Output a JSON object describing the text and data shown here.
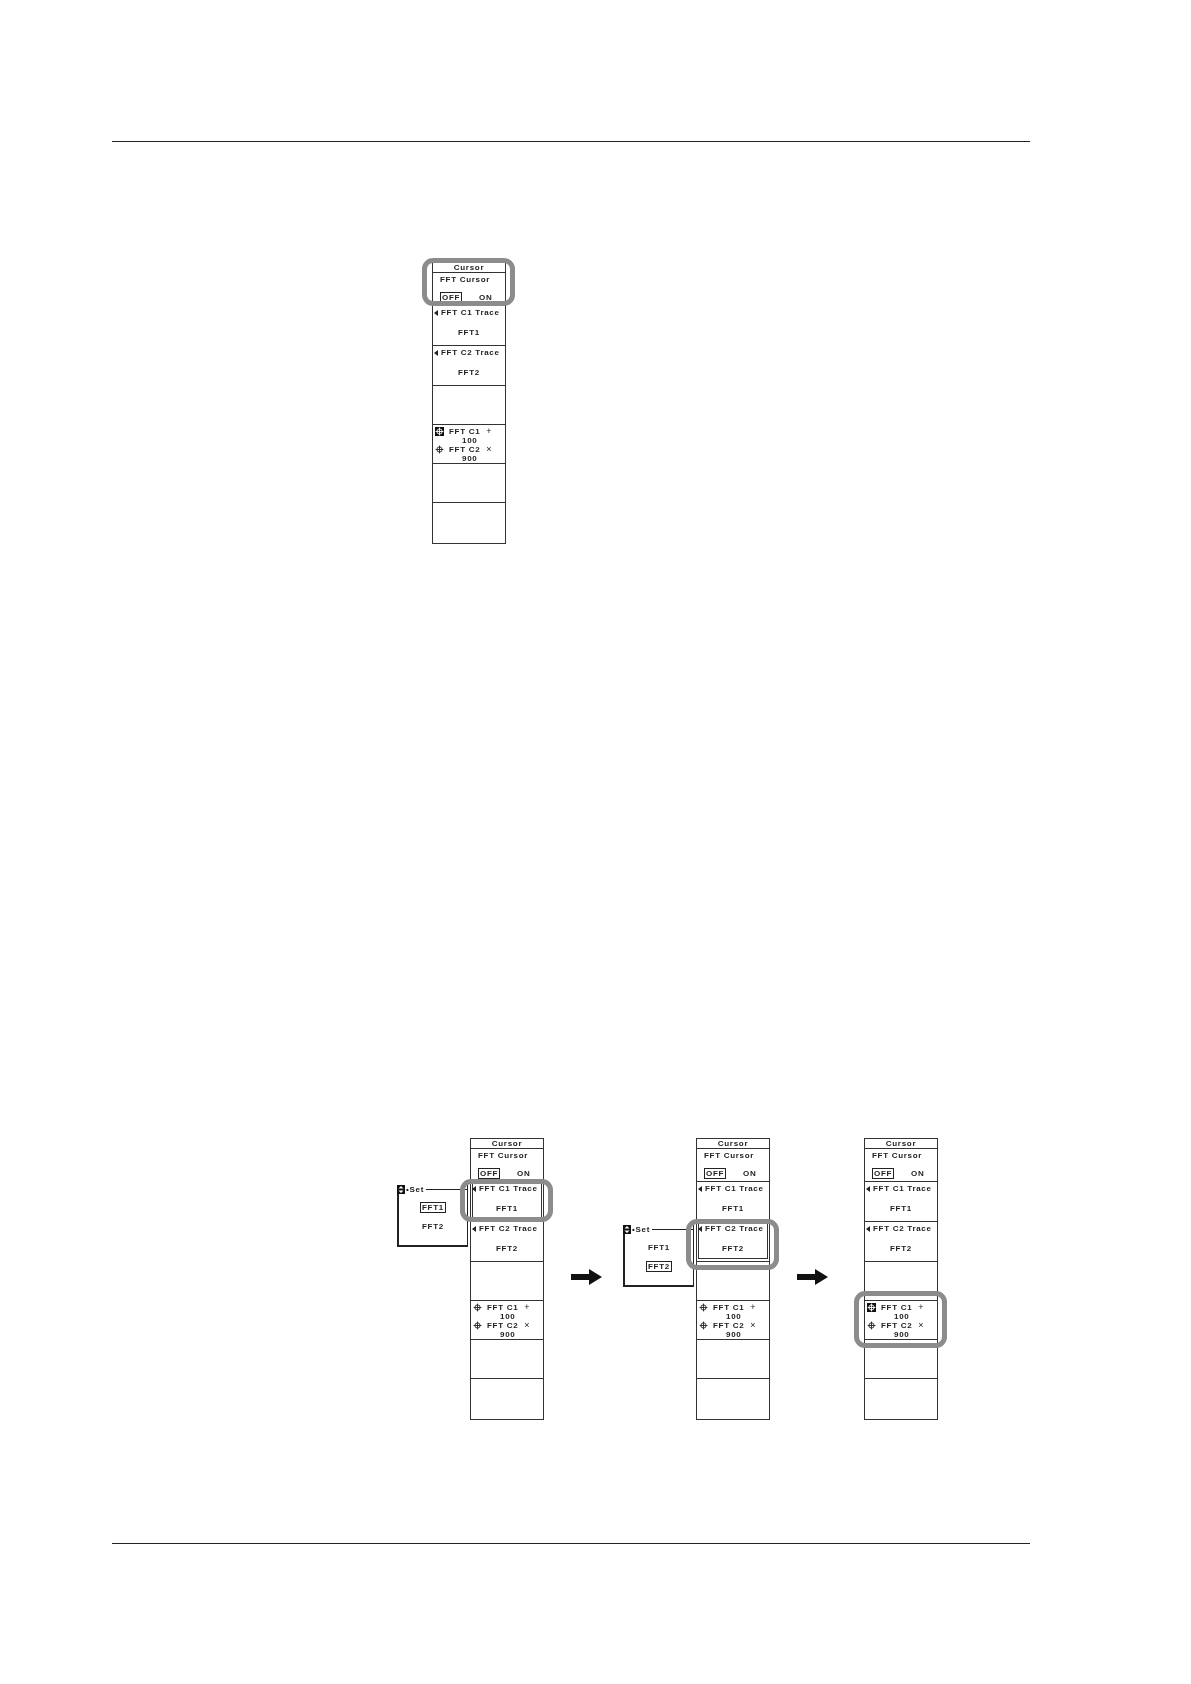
{
  "top_figure": {
    "menu": {
      "title": "Cursor",
      "sections": [
        {
          "kind": "toggle",
          "label": "FFT Cursor",
          "options": [
            {
              "label": "OFF",
              "selected": true
            },
            {
              "label": "ON",
              "selected": false
            }
          ],
          "highlighted": true
        },
        {
          "kind": "select",
          "label": "FFT C1 Trace",
          "value": "FFT1",
          "active": false,
          "highlighted": false
        },
        {
          "kind": "select",
          "label": "FFT C2 Trace",
          "value": "FFT2",
          "active": false,
          "highlighted": false
        },
        {
          "kind": "blank",
          "highlighted": false
        },
        {
          "kind": "readout",
          "cursors": [
            {
              "label": "FFT C1",
              "marker": "+",
              "value": "100",
              "selected": true
            },
            {
              "label": "FFT C2",
              "marker": "×",
              "value": "900",
              "selected": false
            }
          ],
          "highlighted": false
        },
        {
          "kind": "blank",
          "highlighted": false
        },
        {
          "kind": "blank",
          "highlighted": false
        }
      ]
    }
  },
  "steps": [
    {
      "menu": {
        "title": "Cursor",
        "sections": [
          {
            "kind": "toggle",
            "label": "FFT Cursor",
            "options": [
              {
                "label": "OFF",
                "selected": true
              },
              {
                "label": "ON",
                "selected": false
              }
            ],
            "highlighted": false
          },
          {
            "kind": "select",
            "label": "FFT C1 Trace",
            "value": "FFT1",
            "active": true,
            "highlighted": true,
            "popup": {
              "title": "•Set",
              "options": [
                {
                  "label": "FFT1",
                  "selected": true
                },
                {
                  "label": "FFT2",
                  "selected": false
                }
              ]
            }
          },
          {
            "kind": "select",
            "label": "FFT C2 Trace",
            "value": "FFT2",
            "active": false,
            "highlighted": false
          },
          {
            "kind": "blank",
            "highlighted": false
          },
          {
            "kind": "readout",
            "cursors": [
              {
                "label": "FFT C1",
                "marker": "+",
                "value": "100",
                "selected": false
              },
              {
                "label": "FFT C2",
                "marker": "×",
                "value": "900",
                "selected": false
              }
            ],
            "highlighted": false
          },
          {
            "kind": "blank",
            "highlighted": false
          },
          {
            "kind": "blank",
            "highlighted": false
          }
        ]
      }
    },
    {
      "menu": {
        "title": "Cursor",
        "sections": [
          {
            "kind": "toggle",
            "label": "FFT Cursor",
            "options": [
              {
                "label": "OFF",
                "selected": true
              },
              {
                "label": "ON",
                "selected": false
              }
            ],
            "highlighted": false
          },
          {
            "kind": "select",
            "label": "FFT C1 Trace",
            "value": "FFT1",
            "active": false,
            "highlighted": false
          },
          {
            "kind": "select",
            "label": "FFT C2 Trace",
            "value": "FFT2",
            "active": true,
            "highlighted": true,
            "popup": {
              "title": "•Set",
              "options": [
                {
                  "label": "FFT1",
                  "selected": false
                },
                {
                  "label": "FFT2",
                  "selected": true
                }
              ]
            }
          },
          {
            "kind": "blank",
            "highlighted": false
          },
          {
            "kind": "readout",
            "cursors": [
              {
                "label": "FFT C1",
                "marker": "+",
                "value": "100",
                "selected": false
              },
              {
                "label": "FFT C2",
                "marker": "×",
                "value": "900",
                "selected": false
              }
            ],
            "highlighted": false
          },
          {
            "kind": "blank",
            "highlighted": false
          },
          {
            "kind": "blank",
            "highlighted": false
          }
        ]
      }
    },
    {
      "menu": {
        "title": "Cursor",
        "sections": [
          {
            "kind": "toggle",
            "label": "FFT Cursor",
            "options": [
              {
                "label": "OFF",
                "selected": true
              },
              {
                "label": "ON",
                "selected": false
              }
            ],
            "highlighted": false
          },
          {
            "kind": "select",
            "label": "FFT C1 Trace",
            "value": "FFT1",
            "active": false,
            "highlighted": false
          },
          {
            "kind": "select",
            "label": "FFT C2 Trace",
            "value": "FFT2",
            "active": false,
            "highlighted": false
          },
          {
            "kind": "blank",
            "highlighted": false
          },
          {
            "kind": "readout",
            "cursors": [
              {
                "label": "FFT C1",
                "marker": "+",
                "value": "100",
                "selected": true
              },
              {
                "label": "FFT C2",
                "marker": "×",
                "value": "900",
                "selected": false
              }
            ],
            "highlighted": true
          },
          {
            "kind": "blank",
            "highlighted": false
          },
          {
            "kind": "blank",
            "highlighted": false
          }
        ]
      }
    }
  ]
}
